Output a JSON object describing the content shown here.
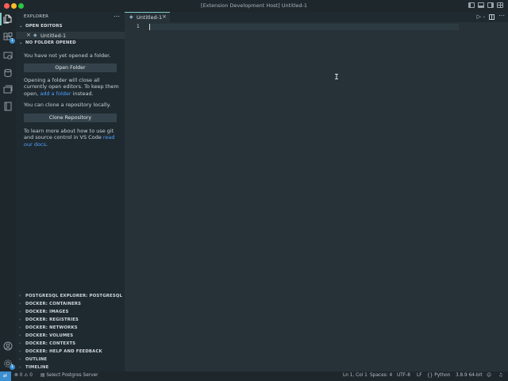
{
  "window": {
    "title": "[Extension Development Host] Untitled-1"
  },
  "sidebar": {
    "header": "EXPLORER",
    "more": "⋯",
    "open_editors": {
      "title": "OPEN EDITORS",
      "items": [
        {
          "label": "Untitled-1"
        }
      ]
    },
    "no_folder": {
      "title": "NO FOLDER OPENED",
      "text1": "You have not yet opened a folder.",
      "open_folder_button": "Open Folder",
      "text2_a": "Opening a folder will close all currently open editors. To keep them open, ",
      "text2_link": "add a folder",
      "text2_b": " instead.",
      "text3": "You can clone a repository locally.",
      "clone_button": "Clone Repository",
      "text4_a": "To learn more about how to use git and source control in VS Code ",
      "text4_link": "read our docs",
      "text4_b": "."
    },
    "panels": [
      "POSTGRESQL EXPLORER: POSTGRESQL",
      "DOCKER: CONTAINERS",
      "DOCKER: IMAGES",
      "DOCKER: REGISTRIES",
      "DOCKER: NETWORKS",
      "DOCKER: VOLUMES",
      "DOCKER: CONTEXTS",
      "DOCKER: HELP AND FEEDBACK",
      "OUTLINE",
      "TIMELINE"
    ]
  },
  "activity": {
    "explorer_badge": "1",
    "settings_badge": "1"
  },
  "editor": {
    "tab_label": "Untitled-1",
    "line_number": "1"
  },
  "status": {
    "errors": "0",
    "warnings": "0",
    "postgres": "Select Postgres Server",
    "position": "Ln 1, Col 1",
    "spaces": "Spaces: 4",
    "encoding": "UTF-8",
    "eol": "LF",
    "language": "Python",
    "interpreter": "3.8.9 64-bit"
  },
  "colors": {
    "accent": "#80cbc4",
    "link": "#4ea1ff",
    "badge": "#3b8ed0",
    "editor_bg": "#263238"
  }
}
